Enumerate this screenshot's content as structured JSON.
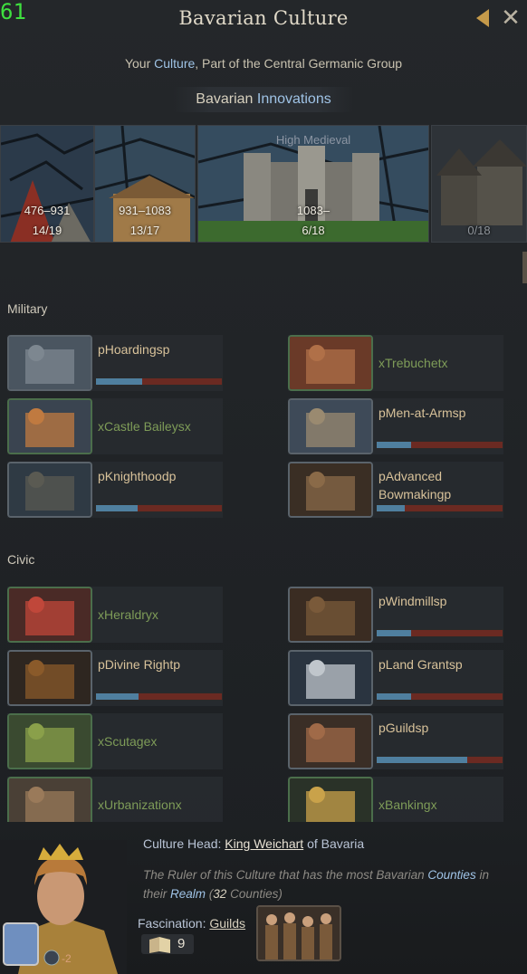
{
  "overlay": {
    "fps": "61"
  },
  "header": {
    "title": "Bavarian Culture"
  },
  "subtitle": {
    "prefix": "Your ",
    "culture_link": "Culture",
    "suffix": ", Part of the Central Germanic Group"
  },
  "innovations_title": {
    "a": "Bavarian ",
    "b": "Innovations"
  },
  "eras": [
    {
      "range": "476–931",
      "count": "14/19"
    },
    {
      "range": "931–1083",
      "count": "13/17"
    },
    {
      "label": "High Medieval",
      "range": "1083–",
      "count": "6/18"
    },
    {
      "range": "",
      "count": "0/18"
    }
  ],
  "sections": {
    "military": "Military",
    "civic": "Civic"
  },
  "military": [
    {
      "name": "pHoardingsp",
      "done": false,
      "progress": 0.37
    },
    {
      "name": "xTrebuchetx",
      "done": true
    },
    {
      "name": "xCastle Baileysx",
      "done": true
    },
    {
      "name": "pMen-at-Armsp",
      "done": false,
      "progress": 0.27
    },
    {
      "name": "pKnighthoodp",
      "done": false,
      "progress": 0.33
    },
    {
      "name": "pAdvanced Bowmakingp",
      "done": false,
      "progress": 0.22
    }
  ],
  "civic": [
    {
      "name": "xHeraldryx",
      "done": true
    },
    {
      "name": "pWindmillsp",
      "done": false,
      "progress": 0.27
    },
    {
      "name": "pDivine Rightp",
      "done": false,
      "progress": 0.34
    },
    {
      "name": "pLand Grantsp",
      "done": false,
      "progress": 0.27
    },
    {
      "name": "xScutagex",
      "done": true
    },
    {
      "name": "pGuildsp",
      "done": false,
      "progress": 0.72
    },
    {
      "name": "xUrbanizationx",
      "done": true
    },
    {
      "name": "xBankingx",
      "done": true
    }
  ],
  "footer": {
    "culture_head_label": "Culture Head: ",
    "culture_head_name": "King Weichart",
    "culture_head_of": " of ",
    "culture_head_realm": "Bavaria",
    "desc_1": "The Ruler of this Culture that has the most Bavarian ",
    "desc_counties": "Counties",
    "desc_2": " in their ",
    "desc_realm": "Realm",
    "desc_3": " (",
    "desc_num": "32",
    "desc_4": " Counties)",
    "fascination_label": "Fascination: ",
    "fascination_value": "Guilds",
    "book_count": "9",
    "modifier": "-2"
  },
  "colors": {
    "accent_gold": "#c59a4a",
    "link_blue": "#9fc3e6",
    "done_green": "#7e9c58",
    "progress_blue": "#4f7f9f",
    "remaining_red": "#6b2a22"
  }
}
